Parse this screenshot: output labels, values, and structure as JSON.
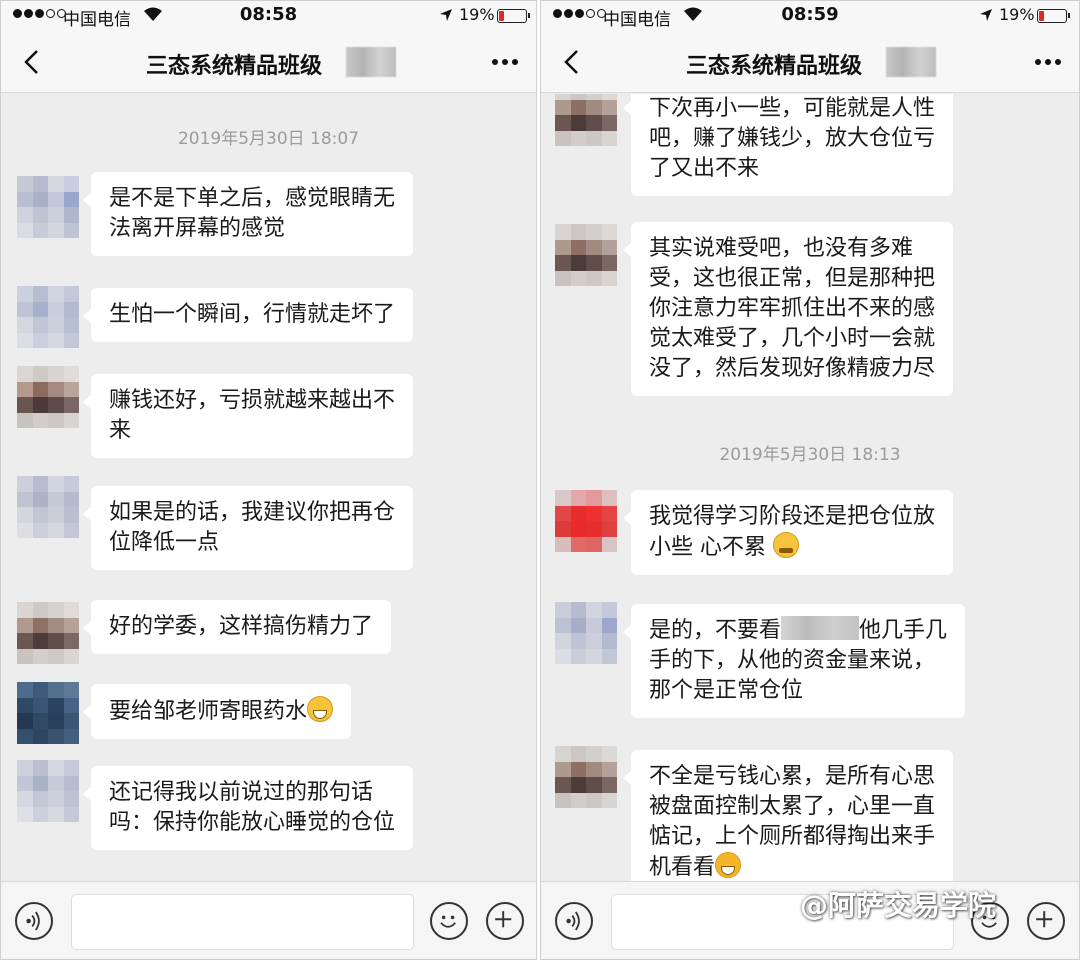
{
  "left_phone": {
    "status": {
      "carrier": "中国电信",
      "time": "08:58",
      "battery": "19%"
    },
    "nav": {
      "title": "三态系统精品班级",
      "back_icon": "chevron-left-icon",
      "more_icon": "more-dots-icon"
    },
    "timestamp": "2019年5月30日 18:07",
    "messages": [
      {
        "lines": [
          "是不是下单之后，感觉眼睛无",
          "法离开屏幕的感觉"
        ]
      },
      {
        "lines": [
          "生怕一个瞬间，行情就走坏了"
        ]
      },
      {
        "lines": [
          "赚钱还好，亏损就越来越出不",
          "来"
        ]
      },
      {
        "lines": [
          "如果是的话，我建议你把再仓",
          "位降低一点"
        ]
      },
      {
        "lines": [
          "好的学委，这样搞伤精力了"
        ]
      },
      {
        "lines": [
          "要给邹老师寄眼药水"
        ],
        "emoji": "grin-emoji"
      },
      {
        "lines": [
          "还记得我以前说过的那句话",
          "吗：保持你能放心睡觉的仓位"
        ]
      }
    ]
  },
  "right_phone": {
    "status": {
      "carrier": "中国电信",
      "time": "08:59",
      "battery": "19%"
    },
    "nav": {
      "title": "三态系统精品班级",
      "back_icon": "chevron-left-icon",
      "more_icon": "more-dots-icon"
    },
    "timestamp": "2019年5月30日 18:13",
    "messages_before": [
      {
        "lines": [
          "下次再小一些，可能就是人性",
          "吧，赚了嫌钱少，放大仓位亏",
          "了又出不来"
        ]
      },
      {
        "lines": [
          "其实说难受吧，也没有多难",
          "受，这也很正常，但是那种把",
          "你注意力牢牢抓住出不来的感",
          "觉太难受了，几个小时一会就",
          "没了，然后发现好像精疲力尽"
        ]
      }
    ],
    "messages_after": [
      {
        "lines": [
          "我觉得学习阶段还是把仓位放",
          "小些 心不累"
        ],
        "emoji": "thinking-emoji"
      },
      {
        "line1_a": "是的，不要看",
        "line1_b": "他几手几",
        "lines_rest": [
          "手的下，从他的资金量来说，",
          "那个是正常仓位"
        ]
      },
      {
        "lines": [
          "不全是亏钱心累，是所有心思",
          "被盘面控制太累了，心里一直",
          "惦记，上个厕所都得掏出来手",
          "机看看"
        ],
        "emoji": "laugh-cry-emoji"
      }
    ]
  },
  "watermark": "@阿萨交易学院"
}
